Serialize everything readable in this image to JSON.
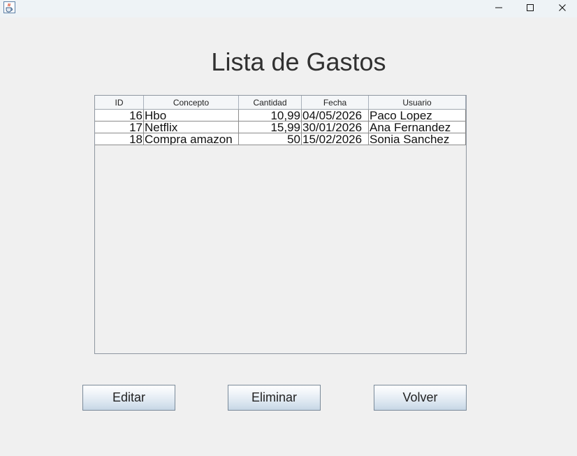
{
  "window": {
    "icon": "java-cup-icon",
    "controls": [
      "minimize-icon",
      "maximize-icon",
      "close-icon"
    ]
  },
  "page": {
    "title": "Lista de Gastos"
  },
  "table": {
    "columns": [
      "ID",
      "Concepto",
      "Cantidad",
      "Fecha",
      "Usuario"
    ],
    "rows": [
      {
        "id": "16",
        "concepto": "Hbo",
        "cantidad": "10,99",
        "fecha": "04/05/2026",
        "usuario": "Paco Lopez"
      },
      {
        "id": "17",
        "concepto": "Netflix",
        "cantidad": "15,99",
        "fecha": "30/01/2026",
        "usuario": "Ana Fernandez"
      },
      {
        "id": "18",
        "concepto": "Compra amazon",
        "cantidad": "50",
        "fecha": "15/02/2026",
        "usuario": "Sonia Sanchez"
      }
    ]
  },
  "buttons": {
    "editar": "Editar",
    "eliminar": "Eliminar",
    "volver": "Volver"
  }
}
